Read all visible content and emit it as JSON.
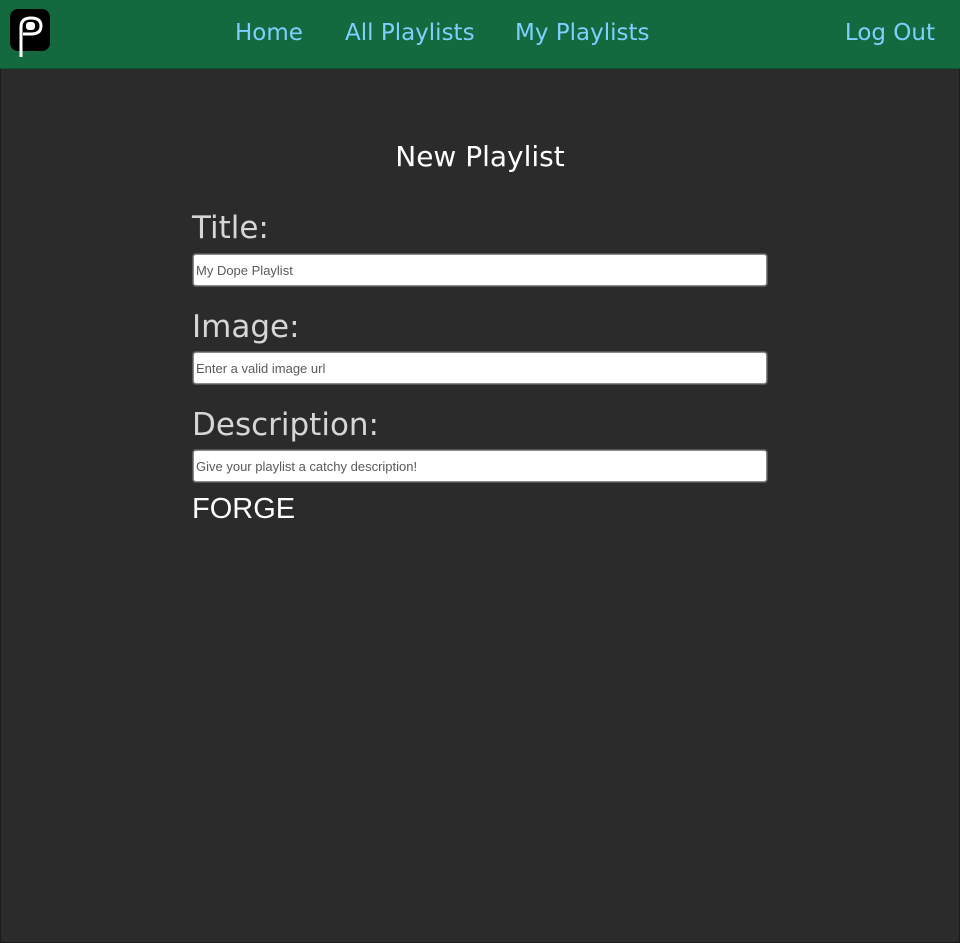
{
  "nav": {
    "logo_icon": "playlist-p-logo",
    "links": [
      {
        "label": "Home"
      },
      {
        "label": "All Playlists"
      },
      {
        "label": "My Playlists"
      }
    ],
    "logout_label": "Log Out",
    "background": "#136a3f",
    "link_color": "#7fd0ff"
  },
  "page": {
    "title": "New Playlist",
    "background": "#2b2b2b"
  },
  "form": {
    "title_label": "Title:",
    "title_placeholder": "My Dope Playlist",
    "title_value": "",
    "image_label": "Image:",
    "image_placeholder": "Enter a valid image url",
    "image_value": "",
    "description_label": "Description:",
    "description_placeholder": "Give your playlist a catchy description!",
    "description_value": "",
    "submit_label": "FORGE"
  }
}
